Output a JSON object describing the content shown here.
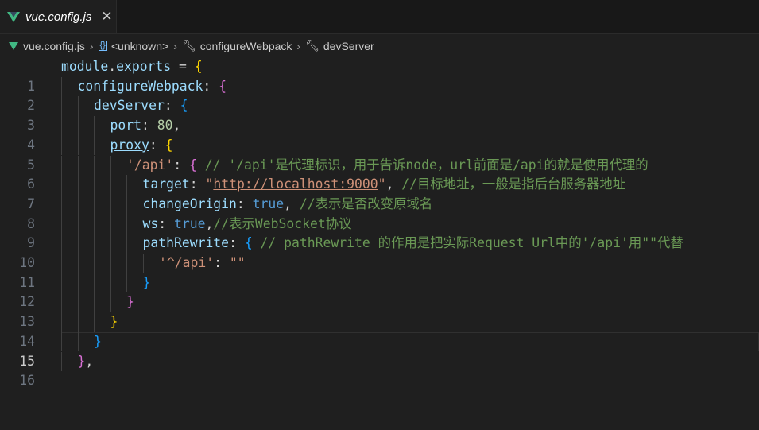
{
  "tab": {
    "title": "vue.config.js",
    "close": "✕"
  },
  "breadcrumb": {
    "file": "vue.config.js",
    "unknown": "<unknown>",
    "configure": "configureWebpack",
    "devserver": "devServer"
  },
  "editor": {
    "active_line": 15,
    "line_numbers": [
      "1",
      "2",
      "3",
      "4",
      "5",
      "6",
      "7",
      "8",
      "9",
      "10",
      "11",
      "12",
      "13",
      "14",
      "15",
      "16"
    ],
    "code": {
      "l1": [
        "module",
        ".",
        "exports",
        " = ",
        "{"
      ],
      "l2": [
        "configureWebpack",
        ": ",
        "{"
      ],
      "l3": [
        "devServer",
        ": ",
        "{"
      ],
      "l4": [
        "port",
        ": ",
        "80",
        ","
      ],
      "l5": [
        "proxy",
        ": ",
        "{"
      ],
      "l6": [
        "'/api'",
        ": ",
        "{",
        " // '/api'是代理标识，用于告诉node，url前面是/api的就是使用代理的"
      ],
      "l7": [
        "target",
        ": ",
        "\"",
        "http://localhost:9000",
        "\"",
        ", ",
        "//目标地址，一般是指后台服务器地址"
      ],
      "l8": [
        "changeOrigin",
        ": ",
        "true",
        ", ",
        "//表示是否改变原域名"
      ],
      "l9": [
        "ws",
        ": ",
        "true",
        ",",
        "//表示WebSocket协议"
      ],
      "l10": [
        "pathRewrite",
        ": ",
        "{",
        " // pathRewrite 的作用是把实际Request Url中的'/api'用\"\"代替"
      ],
      "l11": [
        "'^/api'",
        ": ",
        "\"\""
      ],
      "l12": [
        "}"
      ],
      "l13": [
        "}"
      ],
      "l14": [
        "}"
      ],
      "l15": [
        "}"
      ],
      "l16": [
        "}",
        ","
      ]
    }
  },
  "colors": {
    "background": "#1f1f1f",
    "string": "#ce9178",
    "comment": "#6a9955",
    "keyword": "#569cd6"
  }
}
